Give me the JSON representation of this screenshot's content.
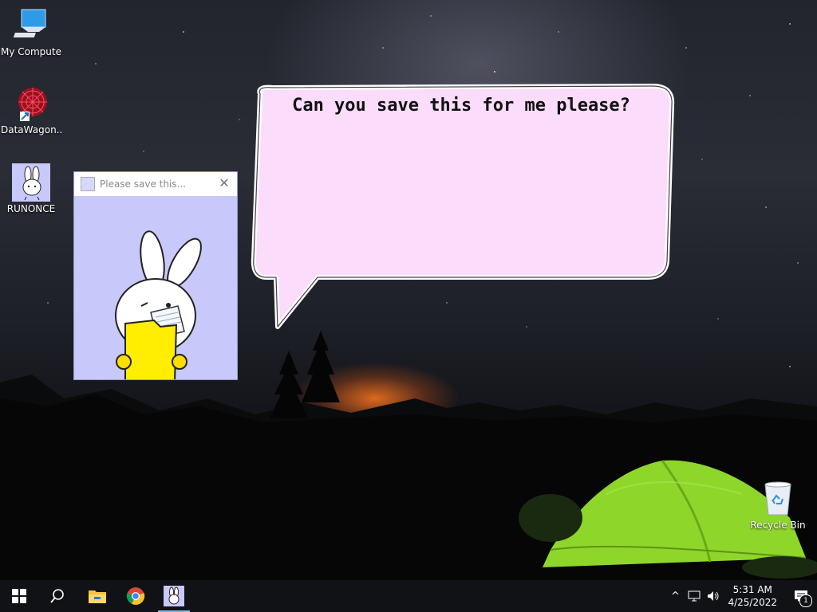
{
  "desktop": {
    "icons": [
      {
        "label": "My Computer",
        "icon": "monitor-icon"
      },
      {
        "label": "DataWagon...",
        "icon": "datawagon-icon"
      },
      {
        "label": "RUNONCE",
        "icon": "bunny-icon"
      },
      {
        "label": "Recycle Bin",
        "icon": "recycle-bin-icon"
      }
    ]
  },
  "popup_window": {
    "title": "Please save this...",
    "close_glyph": "✕"
  },
  "speech_bubble": {
    "text": "Can you save this for me please?"
  },
  "taskbar": {
    "start": "windows-logo-icon",
    "search": "search-icon",
    "pinned": [
      "file-explorer-icon",
      "chrome-icon",
      "runonce-bunny-icon"
    ],
    "tray": {
      "chevron": "^",
      "time": "5:31 AM",
      "date": "4/25/2022",
      "notification_count": "1"
    }
  },
  "colors": {
    "bubble_fill": "#fbdcfb",
    "window_bg": "#c8c8fa",
    "folder_yellow": "#ffee00",
    "tent_green": "#8fd62a",
    "taskbar": "#101215"
  }
}
